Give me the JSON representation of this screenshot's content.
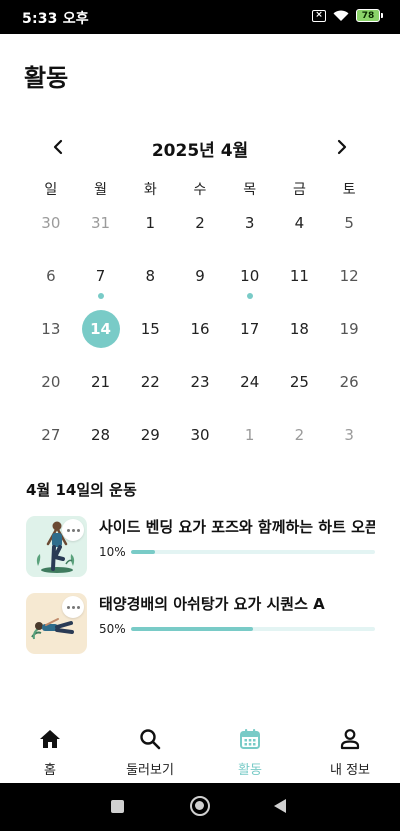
{
  "status_bar": {
    "time": "5:33 오후",
    "battery": "78"
  },
  "page": {
    "title": "활동"
  },
  "calendar": {
    "month_label": "2025년 4월",
    "weekdays": [
      "일",
      "월",
      "화",
      "수",
      "목",
      "금",
      "토"
    ],
    "days": [
      {
        "n": "30",
        "muted": true
      },
      {
        "n": "31",
        "muted": true
      },
      {
        "n": "1"
      },
      {
        "n": "2"
      },
      {
        "n": "3"
      },
      {
        "n": "4"
      },
      {
        "n": "5",
        "weekend": true
      },
      {
        "n": "6",
        "weekend": true
      },
      {
        "n": "7",
        "dot": true
      },
      {
        "n": "8"
      },
      {
        "n": "9"
      },
      {
        "n": "10",
        "dot": true
      },
      {
        "n": "11"
      },
      {
        "n": "12",
        "weekend": true
      },
      {
        "n": "13",
        "weekend": true
      },
      {
        "n": "14",
        "selected": true
      },
      {
        "n": "15"
      },
      {
        "n": "16"
      },
      {
        "n": "17"
      },
      {
        "n": "18"
      },
      {
        "n": "19",
        "weekend": true
      },
      {
        "n": "20",
        "weekend": true
      },
      {
        "n": "21"
      },
      {
        "n": "22"
      },
      {
        "n": "23"
      },
      {
        "n": "24"
      },
      {
        "n": "25"
      },
      {
        "n": "26",
        "weekend": true
      },
      {
        "n": "27",
        "weekend": true
      },
      {
        "n": "28"
      },
      {
        "n": "29"
      },
      {
        "n": "30"
      },
      {
        "n": "1",
        "muted": true
      },
      {
        "n": "2",
        "muted": true
      },
      {
        "n": "3",
        "muted": true
      }
    ]
  },
  "workouts": {
    "section_title": "4월 14일의 운동",
    "items": [
      {
        "title": "사이드 벤딩 요가 포즈와 함께하는 하트 오픈",
        "progress_label": "10%",
        "progress": 0.1,
        "thumb_bg": "#dff2ea"
      },
      {
        "title": "태양경배의 아쉬탕가 요가 시퀀스 A",
        "progress_label": "50%",
        "progress": 0.5,
        "thumb_bg": "#f6e9d2"
      }
    ]
  },
  "bottom_nav": {
    "items": [
      {
        "label": "홈",
        "icon": "home-icon"
      },
      {
        "label": "둘러보기",
        "icon": "search-icon"
      },
      {
        "label": "활동",
        "icon": "calendar-icon",
        "active": true
      },
      {
        "label": "내 정보",
        "icon": "person-icon"
      }
    ]
  },
  "colors": {
    "accent": "#79cbc7",
    "track": "#e3f4f3"
  }
}
